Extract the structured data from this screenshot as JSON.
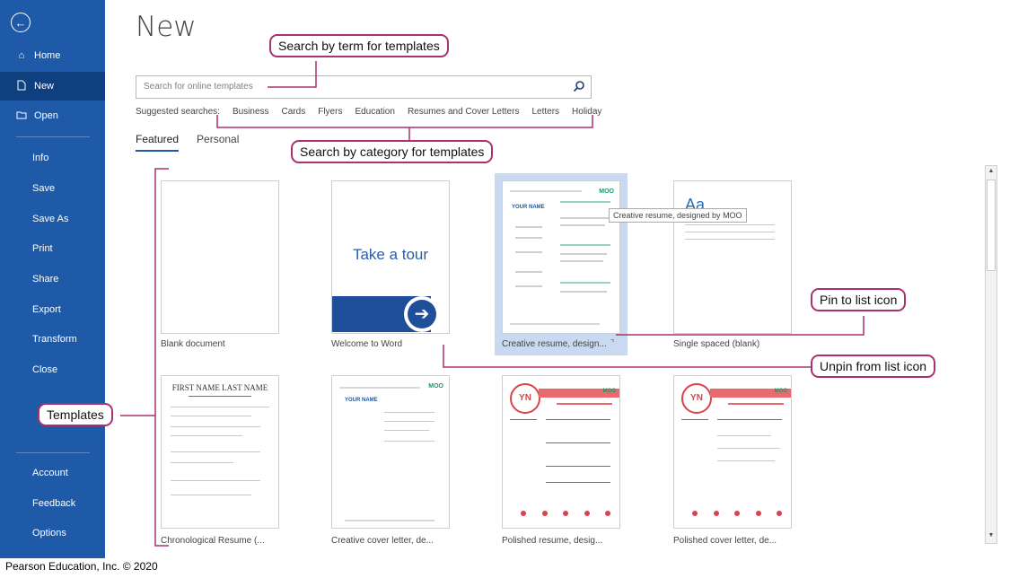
{
  "sidebar": {
    "items": [
      {
        "label": "Home",
        "icon": "home-icon"
      },
      {
        "label": "New",
        "icon": "new-document-icon",
        "active": true
      },
      {
        "label": "Open",
        "icon": "folder-icon"
      },
      {
        "label": "Info"
      },
      {
        "label": "Save"
      },
      {
        "label": "Save As"
      },
      {
        "label": "Print"
      },
      {
        "label": "Share"
      },
      {
        "label": "Export"
      },
      {
        "label": "Transform"
      },
      {
        "label": "Close"
      },
      {
        "label": "Account"
      },
      {
        "label": "Feedback"
      },
      {
        "label": "Options"
      }
    ],
    "back_icon": "back-arrow-icon",
    "accent_color": "#1f5aa8"
  },
  "main": {
    "title": "New",
    "search": {
      "placeholder": "Search for online templates",
      "icon": "search-icon"
    },
    "suggested": {
      "label": "Suggested searches:",
      "items": [
        "Business",
        "Cards",
        "Flyers",
        "Education",
        "Resumes and Cover Letters",
        "Letters",
        "Holiday"
      ]
    },
    "tabs": [
      {
        "label": "Featured",
        "active": true
      },
      {
        "label": "Personal"
      }
    ],
    "templates": [
      {
        "label": "Blank document"
      },
      {
        "label": "Welcome to Word",
        "thumb_text": "Take a tour"
      },
      {
        "label": "Creative resume, design...",
        "moo": "MOO",
        "heading": "YOUR NAME"
      },
      {
        "label": "Single spaced (blank)",
        "thumb_text": "Aa"
      },
      {
        "label": "Chronological Resume (...",
        "name_line": "FIRST NAME LAST NAME"
      },
      {
        "label": "Creative cover letter, de...",
        "heading": "YOUR NAME",
        "moo": "MOO"
      },
      {
        "label": "Polished resume, desig...",
        "initials": "YN",
        "moo": "MOO"
      },
      {
        "label": "Polished cover letter, de...",
        "initials": "YN",
        "moo": "MOO"
      }
    ],
    "tooltip": "Creative resume, designed by MOO"
  },
  "callouts": {
    "search_term": "Search by term for templates",
    "search_category": "Search by category for templates",
    "templates": "Templates",
    "pin": "Pin to list icon",
    "unpin": "Unpin from list icon"
  },
  "footer": "Pearson Education, Inc. © 2020",
  "colors": {
    "callout_border": "#a8326e",
    "tour_blue": "#1f5aa8",
    "resume_red": "#d9444a",
    "moo_green": "#1a9a6a"
  }
}
